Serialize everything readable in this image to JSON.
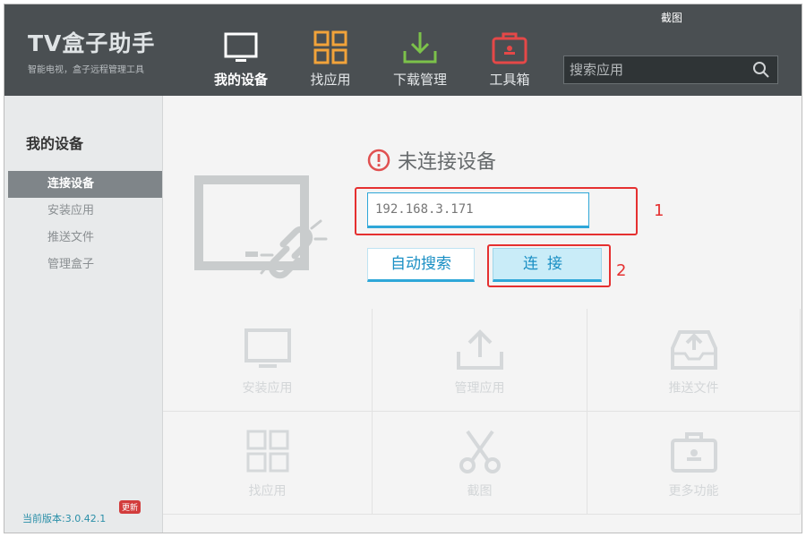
{
  "app": {
    "logo_title": "TV盒子助手",
    "logo_subtitle": "智能电视，盒子远程管理工具",
    "screenshot_label": "截图",
    "accent": "#2ea7d8"
  },
  "nav": {
    "items": [
      {
        "label": "我的设备",
        "icon": "tv-icon"
      },
      {
        "label": "找应用",
        "icon": "grid-icon"
      },
      {
        "label": "下载管理",
        "icon": "download-icon"
      },
      {
        "label": "工具箱",
        "icon": "toolbox-icon"
      }
    ]
  },
  "search": {
    "placeholder": "搜索应用"
  },
  "sidebar": {
    "title": "我的设备",
    "items": [
      {
        "label": "连接设备"
      },
      {
        "label": "安装应用"
      },
      {
        "label": "推送文件"
      },
      {
        "label": "管理盒子"
      }
    ],
    "version": "当前版本:3.0.42.1",
    "update_badge": "更新"
  },
  "main": {
    "status_text": "未连接设备",
    "ip_value": "192.168.3.171",
    "auto_search_label": "自动搜索",
    "connect_label": "连接",
    "annotation_1": "1",
    "annotation_2": "2",
    "features": [
      {
        "label": "安装应用",
        "icon": "monitor-icon"
      },
      {
        "label": "管理应用",
        "icon": "upload-icon"
      },
      {
        "label": "推送文件",
        "icon": "inbox-icon"
      },
      {
        "label": "找应用",
        "icon": "grid-icon"
      },
      {
        "label": "截图",
        "icon": "scissors-icon"
      },
      {
        "label": "更多功能",
        "icon": "toolbox-icon"
      }
    ]
  }
}
